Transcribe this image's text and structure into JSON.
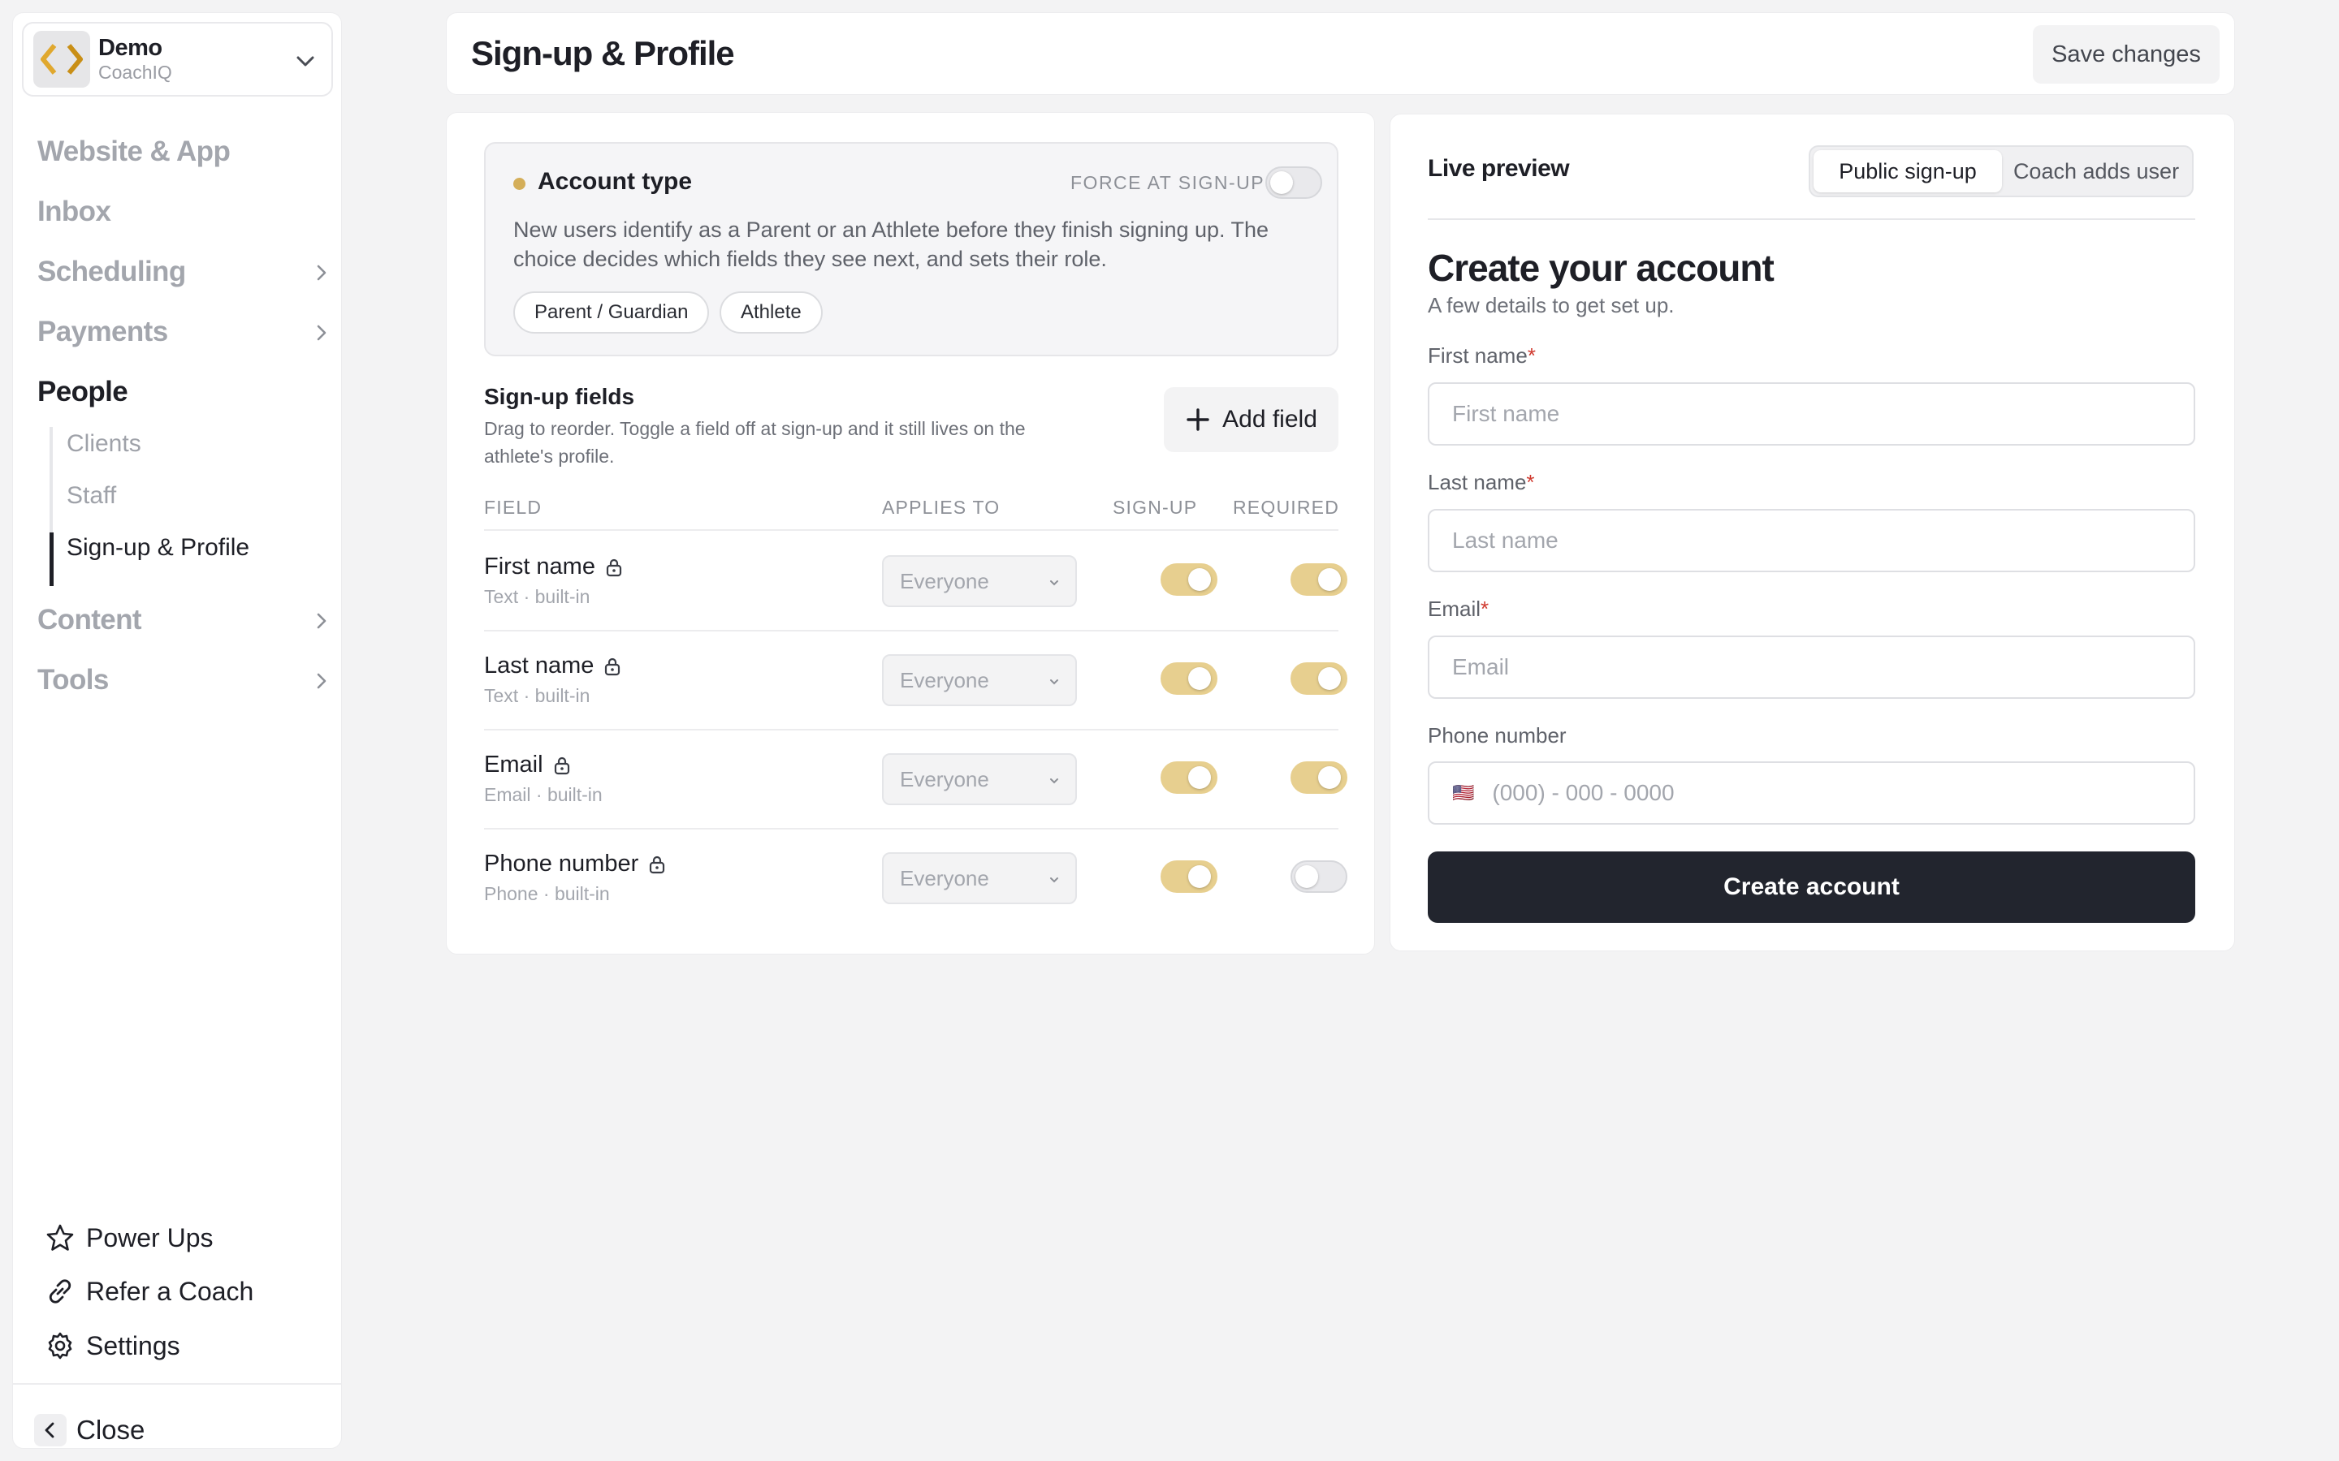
{
  "workspace": {
    "name": "Demo",
    "subtitle": "CoachIQ"
  },
  "nav": {
    "items": [
      {
        "label": "Website & App",
        "has_chevron": false,
        "active": false
      },
      {
        "label": "Inbox",
        "has_chevron": false,
        "active": false
      },
      {
        "label": "Scheduling",
        "has_chevron": true,
        "active": false
      },
      {
        "label": "Payments",
        "has_chevron": true,
        "active": false
      },
      {
        "label": "People",
        "has_chevron": false,
        "active": true
      },
      {
        "label": "Content",
        "has_chevron": true,
        "active": false
      },
      {
        "label": "Tools",
        "has_chevron": true,
        "active": false
      }
    ],
    "people_sub": [
      {
        "label": "Clients",
        "active": false
      },
      {
        "label": "Staff",
        "active": false
      },
      {
        "label": "Sign-up & Profile",
        "active": true
      }
    ],
    "bottom": [
      {
        "label": "Power Ups",
        "icon": "star-icon"
      },
      {
        "label": "Refer a Coach",
        "icon": "link-icon"
      },
      {
        "label": "Settings",
        "icon": "gear-icon"
      }
    ],
    "close_label": "Close"
  },
  "header": {
    "title": "Sign-up & Profile",
    "save_label": "Save changes"
  },
  "account_type": {
    "title": "Account type",
    "force_label": "FORCE AT SIGN-UP",
    "force_on": false,
    "description": "New users identify as a Parent or an Athlete before they finish signing up. The choice decides which fields they see next, and sets their role.",
    "options": [
      "Parent / Guardian",
      "Athlete"
    ]
  },
  "signup_fields": {
    "title": "Sign-up fields",
    "description": "Drag to reorder. Toggle a field off at sign-up and it still lives on the athlete's profile.",
    "add_label": "Add field",
    "columns": {
      "field": "FIELD",
      "applies_to": "APPLIES TO",
      "signup": "SIGN-UP",
      "required": "REQUIRED"
    },
    "rows": [
      {
        "name": "First name",
        "type": "Text · built-in",
        "applies_to": "Everyone",
        "signup": true,
        "required": true
      },
      {
        "name": "Last name",
        "type": "Text · built-in",
        "applies_to": "Everyone",
        "signup": true,
        "required": true
      },
      {
        "name": "Email",
        "type": "Email · built-in",
        "applies_to": "Everyone",
        "signup": true,
        "required": true
      },
      {
        "name": "Phone number",
        "type": "Phone · built-in",
        "applies_to": "Everyone",
        "signup": true,
        "required": false
      }
    ]
  },
  "preview": {
    "title": "Live preview",
    "tabs": [
      "Public sign-up",
      "Coach adds user"
    ],
    "selected_tab": "Public sign-up",
    "form_title": "Create your account",
    "form_subtitle": "A few details to get set up.",
    "fields": [
      {
        "label": "First name",
        "required": true,
        "placeholder": "First name"
      },
      {
        "label": "Last name",
        "required": true,
        "placeholder": "Last name"
      },
      {
        "label": "Email",
        "required": true,
        "placeholder": "Email"
      },
      {
        "label": "Phone number",
        "required": false,
        "placeholder": "(000) - 000 - 0000",
        "flag": "🇺🇸"
      }
    ],
    "required_marker": "*",
    "submit_label": "Create account"
  },
  "colors": {
    "accent_gold": "#d4ae59",
    "toggle_on": "#e7cf8f",
    "primary_button": "#22252e",
    "required_red": "#d03a2f"
  }
}
